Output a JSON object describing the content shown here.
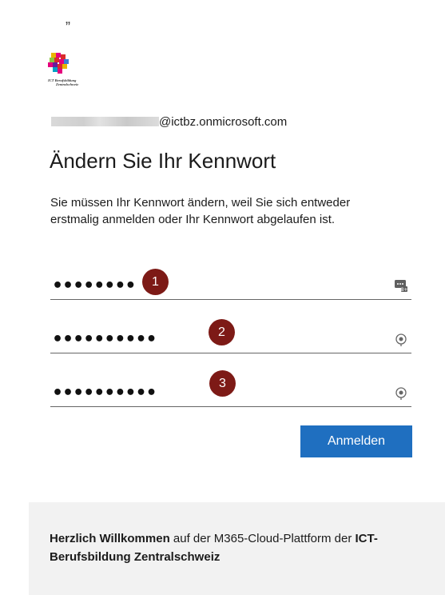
{
  "top_quote": "„",
  "logo": {
    "text_line1": "ICT Berufsbildung",
    "text_line2": "Zentralschweiz"
  },
  "account": {
    "domain": "@ictbz.onmicrosoft.com"
  },
  "title": "Ändern Sie Ihr Kennwort",
  "description": "Sie müssen Ihr Kennwort ändern, weil Sie sich entweder erstmalig anmelden oder Ihr Kennwort abgelaufen ist.",
  "fields": [
    {
      "value": "••••••••",
      "badge": "1",
      "icon": "password-key-icon"
    },
    {
      "value": "••••••••••",
      "badge": "2",
      "icon": "reveal-eye-icon"
    },
    {
      "value": "••••••••••",
      "badge": "3",
      "icon": "reveal-eye-icon"
    }
  ],
  "submit_label": "Anmelden",
  "footer": {
    "welcome_bold": "Herzlich Willkommen",
    "welcome_rest": " auf der M365-Cloud-Plattform der ",
    "org_bold": "ICT-Berufsbildung Zentralschweiz"
  },
  "colors": {
    "badge": "#7d1a16",
    "button": "#1f6fc0",
    "footer_bg": "#f2f2f2"
  }
}
